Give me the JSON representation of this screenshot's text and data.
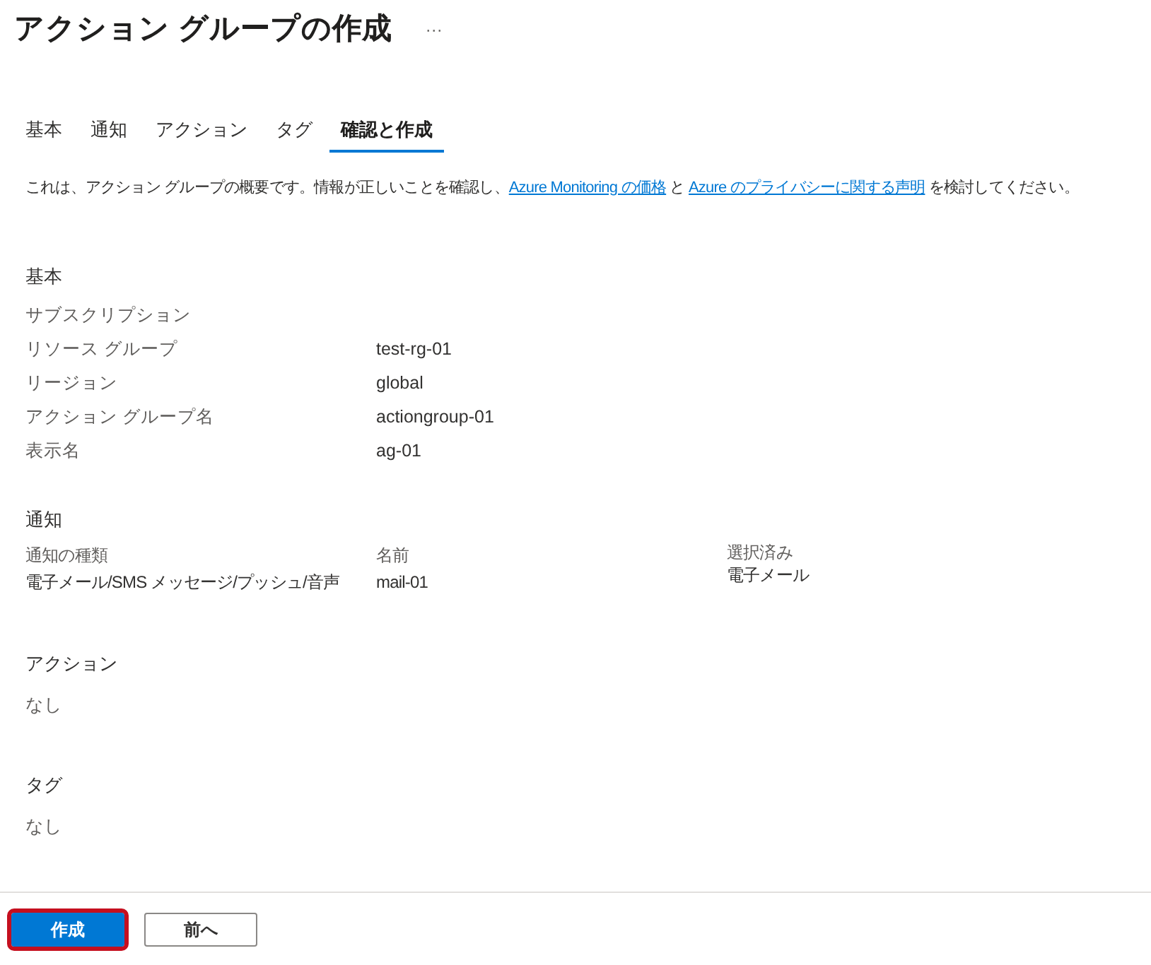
{
  "title": "アクション グループの作成",
  "more": "···",
  "tabs": [
    {
      "label": "基本",
      "selected": false
    },
    {
      "label": "通知",
      "selected": false
    },
    {
      "label": "アクション",
      "selected": false
    },
    {
      "label": "タグ",
      "selected": false
    },
    {
      "label": "確認と作成",
      "selected": true
    }
  ],
  "intro": [
    {
      "kind": "text",
      "text": "これは、アクション グループの概要です。情報が正しいことを確認し、"
    },
    {
      "kind": "link",
      "text": "Azure Monitoring の価格"
    },
    {
      "kind": "text",
      "text": " と "
    },
    {
      "kind": "link",
      "text": "Azure のプライバシーに関する声明"
    },
    {
      "kind": "text",
      "text": " を検討してください。"
    }
  ],
  "basics": {
    "heading": "基本",
    "rows": [
      {
        "label": "サブスクリプション"
      },
      {
        "label": "リソース グループ",
        "value": "test-rg-01"
      },
      {
        "label": "リージョン",
        "value": "global"
      },
      {
        "label": "アクション グループ名",
        "value": "actiongroup-01"
      },
      {
        "label": "表示名",
        "value": "ag-01"
      }
    ]
  },
  "notifications": {
    "heading": "通知",
    "columns": [
      "通知の種類",
      "名前",
      "選択済み"
    ],
    "rows": [
      [
        "電子メール/SMS メッセージ/プッシュ/音声",
        "mail-01",
        "電子メール"
      ]
    ]
  },
  "actions": {
    "heading": "アクション",
    "value": "なし"
  },
  "tags": {
    "heading": "タグ",
    "value": "なし"
  },
  "buttons": [
    {
      "label": "作成",
      "kind": "primary",
      "highlighted": true
    },
    {
      "label": "前へ",
      "kind": "secondary",
      "highlighted": false
    }
  ]
}
